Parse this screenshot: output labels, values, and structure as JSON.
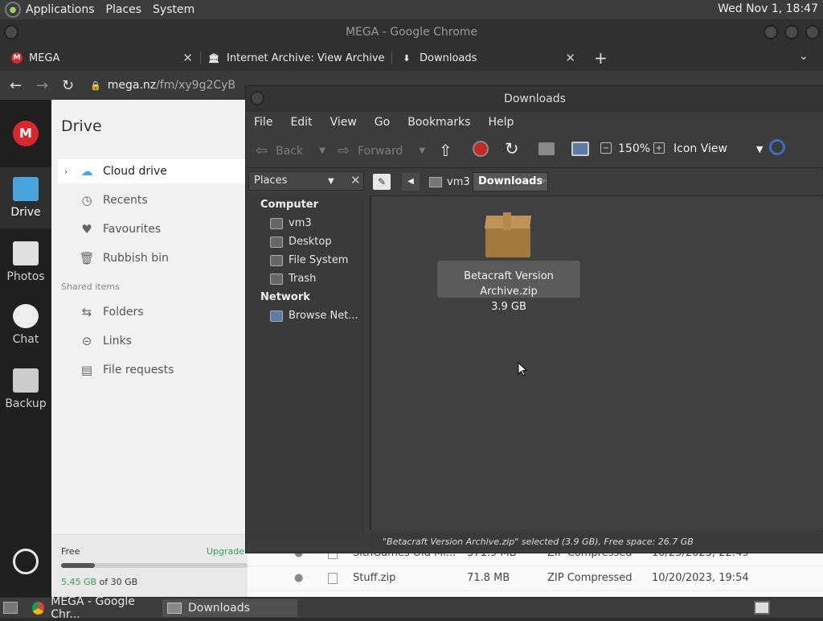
{
  "system_panel": {
    "menus": [
      "Applications",
      "Places",
      "System"
    ],
    "clock": "Wed Nov 1, 18:47"
  },
  "chrome": {
    "window_title": "MEGA - Google Chrome",
    "tabs": [
      {
        "label": "MEGA",
        "icon": "mega-icon"
      },
      {
        "label": "Internet Archive: View Archive",
        "icon": "archive-icon"
      },
      {
        "label": "Downloads",
        "icon": "download-icon"
      }
    ],
    "url_host": "mega.nz",
    "url_path": "/fm/xy9g2CyB"
  },
  "mega": {
    "rail": [
      {
        "label": "Drive",
        "icon": "folder-icon"
      },
      {
        "label": "Photos",
        "icon": "photo-icon"
      },
      {
        "label": "Chat",
        "icon": "chat-icon"
      },
      {
        "label": "Backup",
        "icon": "backup-icon"
      }
    ],
    "sidebar_title": "Drive",
    "nav": [
      {
        "label": "Cloud drive",
        "icon": "cloud-icon"
      },
      {
        "label": "Recents",
        "icon": "clock-icon"
      },
      {
        "label": "Favourites",
        "icon": "heart-icon"
      },
      {
        "label": "Rubbish bin",
        "icon": "trash-icon"
      }
    ],
    "shared_label": "Shared items",
    "shared": [
      {
        "label": "Folders",
        "icon": "shared-folder-icon"
      },
      {
        "label": "Links",
        "icon": "link-icon"
      },
      {
        "label": "File requests",
        "icon": "file-request-icon"
      }
    ],
    "storage": {
      "plan": "Free",
      "upgrade": "Upgrade",
      "used": "5.45 GB",
      "total_text": " of 30 GB",
      "fraction": 0.18
    },
    "files": [
      {
        "name": "SithGames Old Mi...",
        "size": "371.9 MB",
        "type": "ZIP Compressed",
        "date": "10/25/2023, 22:49"
      },
      {
        "name": "Stuff.zip",
        "size": "71.8 MB",
        "type": "ZIP Compressed",
        "date": "10/20/2023, 19:54"
      }
    ]
  },
  "file_manager": {
    "title": "Downloads",
    "menus": [
      "File",
      "Edit",
      "View",
      "Go",
      "Bookmarks",
      "Help"
    ],
    "toolbar": {
      "back": "Back",
      "forward": "Forward",
      "zoom": "150%",
      "view_mode": "Icon View"
    },
    "places_header": "Places",
    "places": {
      "computer_header": "Computer",
      "computer": [
        "vm3",
        "Desktop",
        "File System",
        "Trash"
      ],
      "network_header": "Network",
      "network": [
        "Browse Net..."
      ]
    },
    "path": [
      "vm3",
      "Downloads"
    ],
    "items": [
      {
        "name": "Betacraft Version Archive.zip",
        "size": "3.9 GB"
      }
    ],
    "status": "\"Betacraft Version Archive.zip\" selected (3.9 GB), Free space: 26.7 GB"
  },
  "taskbar": {
    "tasks": [
      "MEGA - Google Chr...",
      "Downloads"
    ]
  }
}
